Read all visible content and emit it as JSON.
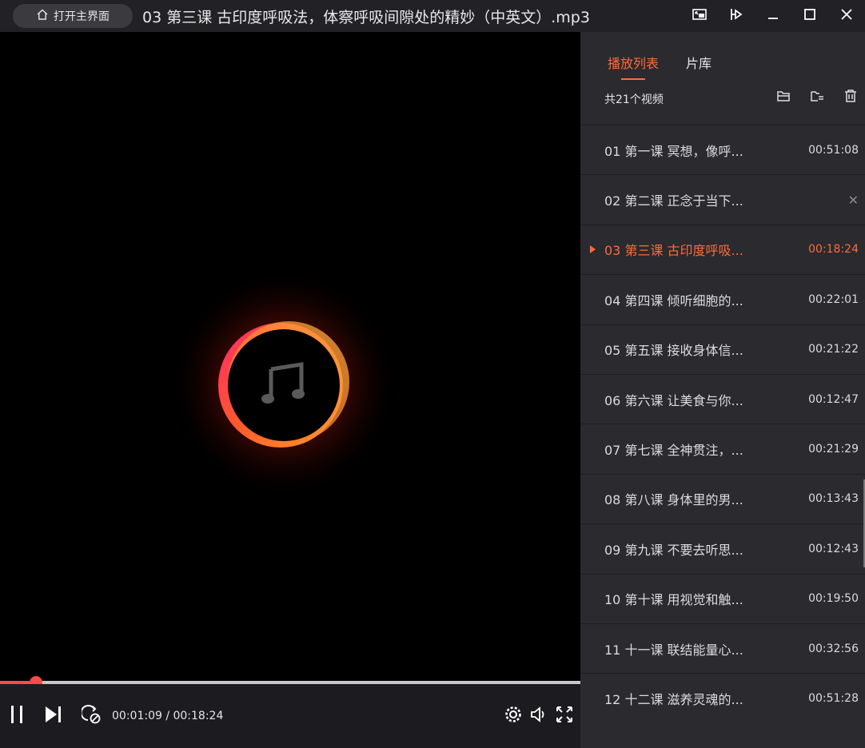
{
  "titlebar": {
    "home_label": "打开主界面",
    "title": "03 第三课 古印度呼吸法，体察呼吸间隙处的精妙（中英文）.mp3"
  },
  "player": {
    "time_display": "00:01:09 / 00:18:24",
    "progress": 0.0625,
    "accent_color": "#ff4a4a"
  },
  "sidebar": {
    "tabs": [
      {
        "label": "播放列表",
        "active": true
      },
      {
        "label": "片库",
        "active": false
      }
    ],
    "count_label": "共21个视频",
    "accent_color": "#ff6a3d",
    "items": [
      {
        "name": "01 第一课 冥想，像呼...",
        "duration": "00:51:08"
      },
      {
        "name": "02 第二课 正念于当下...",
        "duration": "",
        "removable": true
      },
      {
        "name": "03 第三课 古印度呼吸...",
        "duration": "00:18:24",
        "active": true
      },
      {
        "name": "04 第四课 倾听细胞的...",
        "duration": "00:22:01"
      },
      {
        "name": "05 第五课 接收身体信...",
        "duration": "00:21:22"
      },
      {
        "name": "06 第六课 让美食与你...",
        "duration": "00:12:47"
      },
      {
        "name": "07 第七课 全神贯注，...",
        "duration": "00:21:29"
      },
      {
        "name": "08 第八课 身体里的男...",
        "duration": "00:13:43"
      },
      {
        "name": "09 第九课 不要去听思...",
        "duration": "00:12:43"
      },
      {
        "name": "10 第十课 用视觉和触...",
        "duration": "00:19:50"
      },
      {
        "name": "11 十一课 联结能量心...",
        "duration": "00:32:56"
      },
      {
        "name": "12 十二课 滋养灵魂的...",
        "duration": "00:51:28"
      }
    ]
  }
}
